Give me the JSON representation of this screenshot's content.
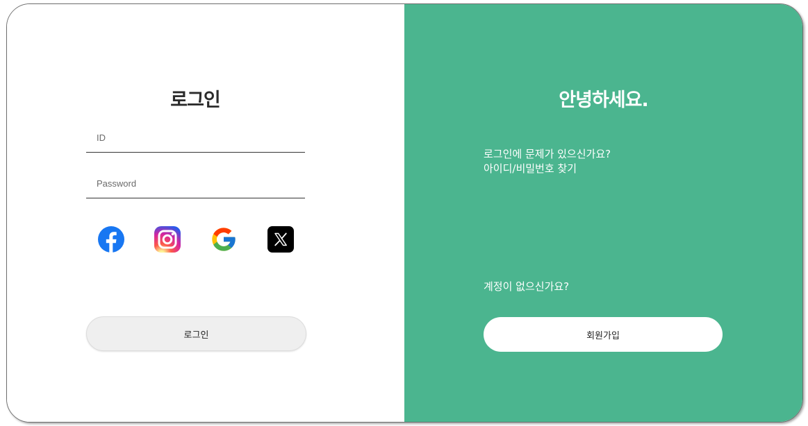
{
  "login": {
    "title": "로그인",
    "id_placeholder": "ID",
    "password_placeholder": "Password",
    "submit_label": "로그인"
  },
  "social": [
    {
      "icon": "facebook-icon"
    },
    {
      "icon": "instagram-icon"
    },
    {
      "icon": "google-icon"
    },
    {
      "icon": "x-icon"
    }
  ],
  "welcome": {
    "title": "안녕하세요.",
    "help_question": "로그인에 문제가 있으신가요?",
    "find_link": "아이디/비밀번호 찾기",
    "no_account": "계정이 없으신가요?",
    "signup_label": "회원가입"
  },
  "colors": {
    "accent": "#4bb58f",
    "login_button": "#efefef",
    "facebook": "#1877f2"
  }
}
